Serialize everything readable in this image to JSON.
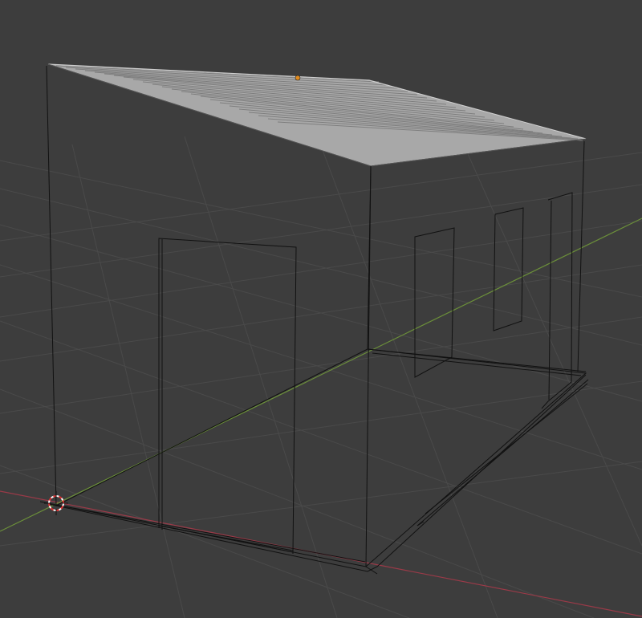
{
  "viewport": {
    "background": "#3d3d3d",
    "grid_color": "#4a4a4a",
    "x_axis_color": "#9a3a48",
    "y_axis_color": "#6b8f3a",
    "wire_color": "#111111",
    "roof_color": "#a8a8a8",
    "roof_rib_color": "#7e7e7e",
    "origin_dot_color": "#e08a1e",
    "cursor_colors": [
      "#e03030",
      "#ffffff"
    ]
  },
  "scene": {
    "object": "wireframe-building-with-corrugated-roof",
    "icons": [
      "3d-cursor-icon",
      "object-origin-icon"
    ]
  }
}
